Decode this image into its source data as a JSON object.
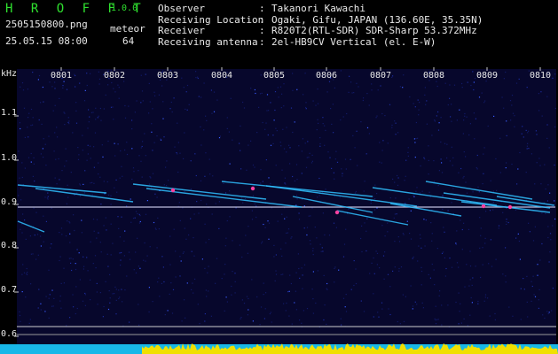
{
  "header": {
    "app_title": "H R O F F T",
    "app_version": "1.0.0",
    "file_name": "2505150800.png",
    "date_time": "25.05.15 08:00",
    "meteor_label": "meteor",
    "meteor_count": "64"
  },
  "meta": [
    {
      "key": "Observer",
      "value": "Takanori Kawachi"
    },
    {
      "key": "Receiving Location",
      "value": "Ogaki, Gifu, JAPAN (136.60E, 35.35N)"
    },
    {
      "key": "Receiver",
      "value": "R820T2(RTL-SDR) SDR-Sharp 53.372MHz"
    },
    {
      "key": "Receiving antenna",
      "value": "2el-HB9CV Vertical (el. E-W)"
    }
  ],
  "spectrogram": {
    "y_unit": "kHz",
    "y_ticks": [
      "1.1",
      "1.0",
      "0.9",
      "0.8",
      "0.7",
      "0.6"
    ],
    "x_ticks": [
      "0801",
      "0802",
      "0803",
      "0804",
      "0805",
      "0806",
      "0807",
      "0808",
      "0809",
      "0810"
    ],
    "carrier_khz": 0.89,
    "colors": {
      "background": "#07072c",
      "carrier": "#e0e0ff",
      "trail": "#30c0ff",
      "hot": "#ff40a0",
      "band": "#18b8e8",
      "level": "#f0e000"
    }
  }
}
